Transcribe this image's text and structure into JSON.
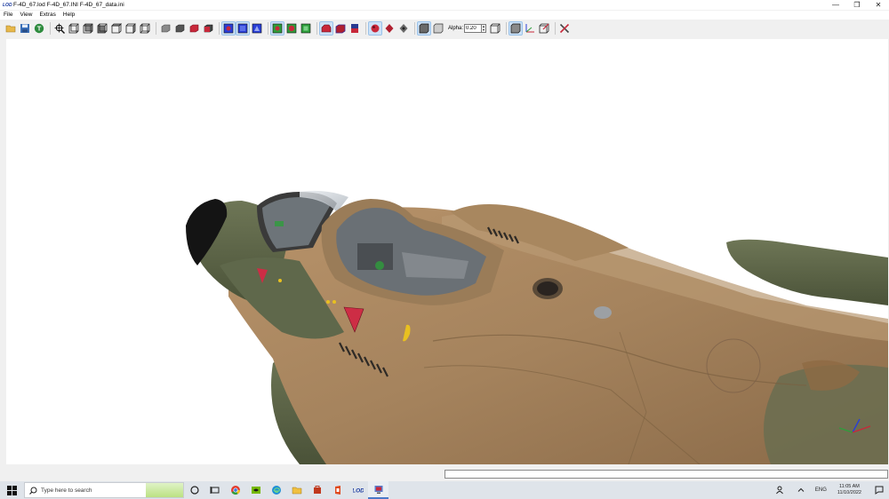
{
  "window": {
    "app_icon_text": "LOD",
    "title": "F-4D_67.lod  F-4D_67.INI  F-4D_67_data.ini",
    "minimize": "—",
    "maximize": "❐",
    "close": "✕"
  },
  "menu": [
    {
      "label": "File"
    },
    {
      "label": "View"
    },
    {
      "label": "Extras"
    },
    {
      "label": "Help"
    }
  ],
  "toolbar": {
    "alpha_label": "Alpha:",
    "alpha_value": "0.20",
    "groups": [
      [
        "open-folder-icon",
        "save-disk-icon",
        "texture-t-icon"
      ],
      [
        "zoom-crosshair-icon",
        "view-front-icon",
        "view-side-icon",
        "view-top-icon",
        "view-back-icon",
        "view-left-icon",
        "view-bottom-icon"
      ],
      [
        "cube-gray-icon",
        "cube-dark-icon",
        "cube-red-icon",
        "cube-split-icon"
      ],
      [
        "render-blue-1-icon",
        "render-blue-2-icon",
        "render-blue-3-icon"
      ],
      [
        "render-green-1-icon",
        "render-green-2-icon",
        "render-green-3-icon"
      ],
      [
        "material-red-1-icon",
        "material-red-2-icon",
        "material-red-3-icon"
      ],
      [
        "mesh-red-1-icon",
        "mesh-red-2-icon",
        "mesh-gray-icon"
      ],
      [
        "solid-box-icon",
        "transparent-box-icon"
      ]
    ],
    "after_alpha": [
      "wire-box-icon",
      "selected-box-icon",
      "axes-icon",
      "cube-edit-icon",
      "tools-icon"
    ]
  },
  "taskbar": {
    "search_placeholder": "Type here to search",
    "language": "ENG",
    "time": "11:05 AM",
    "date": "11/10/2022"
  },
  "colors": {
    "tan": "#a5835d",
    "olive": "#5f684b",
    "accent": "#cd2d45"
  }
}
